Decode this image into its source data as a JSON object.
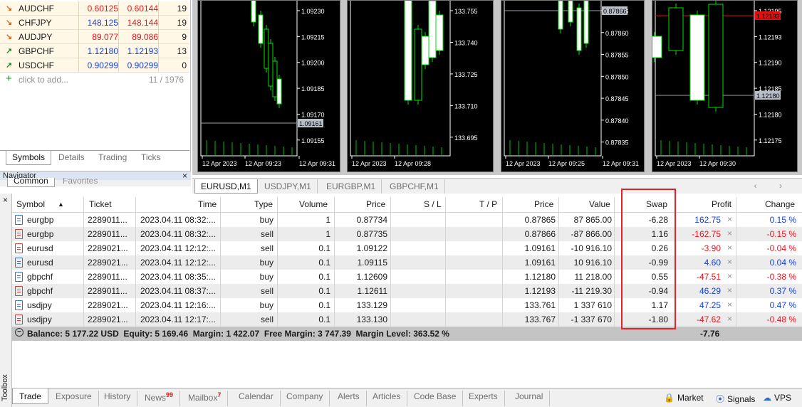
{
  "market_watch": {
    "rows": [
      {
        "arrow": "↘",
        "symbol": "AUDCHF",
        "bid": "0.60125",
        "ask": "0.60144",
        "spread": "19",
        "dir": "down"
      },
      {
        "arrow": "↘",
        "symbol": "CHFJPY",
        "bid": "148.125",
        "ask": "148.144",
        "spread": "19",
        "dir": "mixed"
      },
      {
        "arrow": "↘",
        "symbol": "AUDJPY",
        "bid": "89.077",
        "ask": "89.086",
        "spread": "9",
        "dir": "down"
      },
      {
        "arrow": "↗",
        "symbol": "GBPCHF",
        "bid": "1.12180",
        "ask": "1.12193",
        "spread": "13",
        "dir": "up"
      },
      {
        "arrow": "↗",
        "symbol": "USDCHF",
        "bid": "0.90299",
        "ask": "0.90299",
        "spread": "0",
        "dir": "up"
      }
    ],
    "add_label": "click to add...",
    "count": "11 / 1976",
    "tabs": [
      "Symbols",
      "Details",
      "Trading",
      "Ticks"
    ]
  },
  "navigator": {
    "title": "Navigator",
    "close": "×",
    "tabs": [
      "Common",
      "Favorites"
    ]
  },
  "charts": [
    {
      "prices": [
        "1.09230",
        "1.09215",
        "1.09200",
        "1.09185",
        "1.09170",
        "1.09155"
      ],
      "current": "1.09161",
      "times": [
        "12 Apr 2023",
        "12 Apr 09:23",
        "12 Apr 09:31"
      ]
    },
    {
      "prices": [
        "133.755",
        "133.740",
        "133.725",
        "133.710",
        "133.695"
      ],
      "current": "",
      "times": [
        "12 Apr 2023",
        "12 Apr 09:28"
      ]
    },
    {
      "prices": [
        "0.87866",
        "0.87860",
        "0.87855",
        "0.87850",
        "0.87845",
        "0.87840",
        "0.87835"
      ],
      "current": "0.87866",
      "times": [
        "12 Apr 2023",
        "12 Apr 09:25",
        "12 Apr 09:31"
      ]
    },
    {
      "prices": [
        "1.12195",
        "1.12193",
        "1.12190",
        "1.12185",
        "1.12180",
        "1.12175"
      ],
      "current": "1.12180",
      "ask_label": "1.12193",
      "times": [
        "12 Apr 2023",
        "12 Apr 09:30"
      ]
    }
  ],
  "chart_tabs": [
    "EURUSD,M1",
    "USDJPY,M1",
    "EURGBP,M1",
    "GBPCHF,M1"
  ],
  "chart_tabs_nav": "‹ ›",
  "trade": {
    "headers": {
      "symbol": "Symbol",
      "sort": "▲",
      "ticket": "Ticket",
      "time": "Time",
      "type": "Type",
      "volume": "Volume",
      "price": "Price",
      "sl": "S / L",
      "tp": "T / P",
      "cur_price": "Price",
      "value": "Value",
      "swap": "Swap",
      "profit": "Profit",
      "change": "Change"
    },
    "rows": [
      {
        "symbol": "eurgbp",
        "ticket": "2289011...",
        "time": "2023.04.11 08:32:...",
        "type": "buy",
        "volume": "1",
        "price": "0.87734",
        "cur_price": "0.87865",
        "value": "87 865.00",
        "swap": "-6.28",
        "profit": "162.75",
        "change": "0.15 %",
        "sign": "pos"
      },
      {
        "symbol": "eurgbp",
        "ticket": "2289011...",
        "time": "2023.04.11 08:32:...",
        "type": "sell",
        "volume": "1",
        "price": "0.87735",
        "cur_price": "0.87866",
        "value": "-87 866.00",
        "swap": "1.16",
        "profit": "-162.75",
        "change": "-0.15 %",
        "sign": "neg"
      },
      {
        "symbol": "eurusd",
        "ticket": "2289021...",
        "time": "2023.04.11 12:12:...",
        "type": "sell",
        "volume": "0.1",
        "price": "1.09122",
        "cur_price": "1.09161",
        "value": "-10 916.10",
        "swap": "0.26",
        "profit": "-3.90",
        "change": "-0.04 %",
        "sign": "neg"
      },
      {
        "symbol": "eurusd",
        "ticket": "2289021...",
        "time": "2023.04.11 12:12:...",
        "type": "buy",
        "volume": "0.1",
        "price": "1.09115",
        "cur_price": "1.09161",
        "value": "10 916.10",
        "swap": "-0.99",
        "profit": "4.60",
        "change": "0.04 %",
        "sign": "pos"
      },
      {
        "symbol": "gbpchf",
        "ticket": "2289011...",
        "time": "2023.04.11 08:35:...",
        "type": "buy",
        "volume": "0.1",
        "price": "1.12609",
        "cur_price": "1.12180",
        "value": "11 218.00",
        "swap": "0.55",
        "profit": "-47.51",
        "change": "-0.38 %",
        "sign": "neg"
      },
      {
        "symbol": "gbpchf",
        "ticket": "2289011...",
        "time": "2023.04.11 08:37:...",
        "type": "sell",
        "volume": "0.1",
        "price": "1.12611",
        "cur_price": "1.12193",
        "value": "-11 219.30",
        "swap": "-0.94",
        "profit": "46.29",
        "change": "0.37 %",
        "sign": "pos"
      },
      {
        "symbol": "usdjpy",
        "ticket": "2289021...",
        "time": "2023.04.11 12:16:...",
        "type": "buy",
        "volume": "0.1",
        "price": "133.129",
        "cur_price": "133.761",
        "value": "1 337 610",
        "swap": "1.17",
        "profit": "47.25",
        "change": "0.47 %",
        "sign": "pos"
      },
      {
        "symbol": "usdjpy",
        "ticket": "2289021...",
        "time": "2023.04.11 12:17:...",
        "type": "sell",
        "volume": "0.1",
        "price": "133.130",
        "cur_price": "133.767",
        "value": "-1 337 670",
        "swap": "-1.80",
        "profit": "-47.62",
        "change": "-0.48 %",
        "sign": "neg"
      }
    ],
    "close_glyph": "×",
    "summary": "Balance: 5 177.22 USD  Equity: 5 169.46  Margin: 1 422.07  Free Margin: 3 747.39  Margin Level: 363.52 %",
    "summary_total": "-7.76"
  },
  "toolbox": {
    "label": "Toolbox",
    "close": "×"
  },
  "bottom_tabs": [
    {
      "label": "Trade",
      "badge": ""
    },
    {
      "label": "Exposure",
      "badge": ""
    },
    {
      "label": "History",
      "badge": ""
    },
    {
      "label": "News",
      "badge": "99"
    },
    {
      "label": "Mailbox",
      "badge": "7"
    },
    {
      "label": "Calendar",
      "badge": ""
    },
    {
      "label": "Company",
      "badge": ""
    },
    {
      "label": "Alerts",
      "badge": ""
    },
    {
      "label": "Articles",
      "badge": ""
    },
    {
      "label": "Code Base",
      "badge": ""
    },
    {
      "label": "Experts",
      "badge": ""
    },
    {
      "label": "Journal",
      "badge": ""
    }
  ],
  "bottom_right": {
    "market": "Market",
    "signals": "Signals",
    "vps": "VPS"
  },
  "colors": {
    "positive": "#1740d8",
    "negative": "#e8141e",
    "highlight": "#e8202a",
    "candle": "#00e000"
  }
}
